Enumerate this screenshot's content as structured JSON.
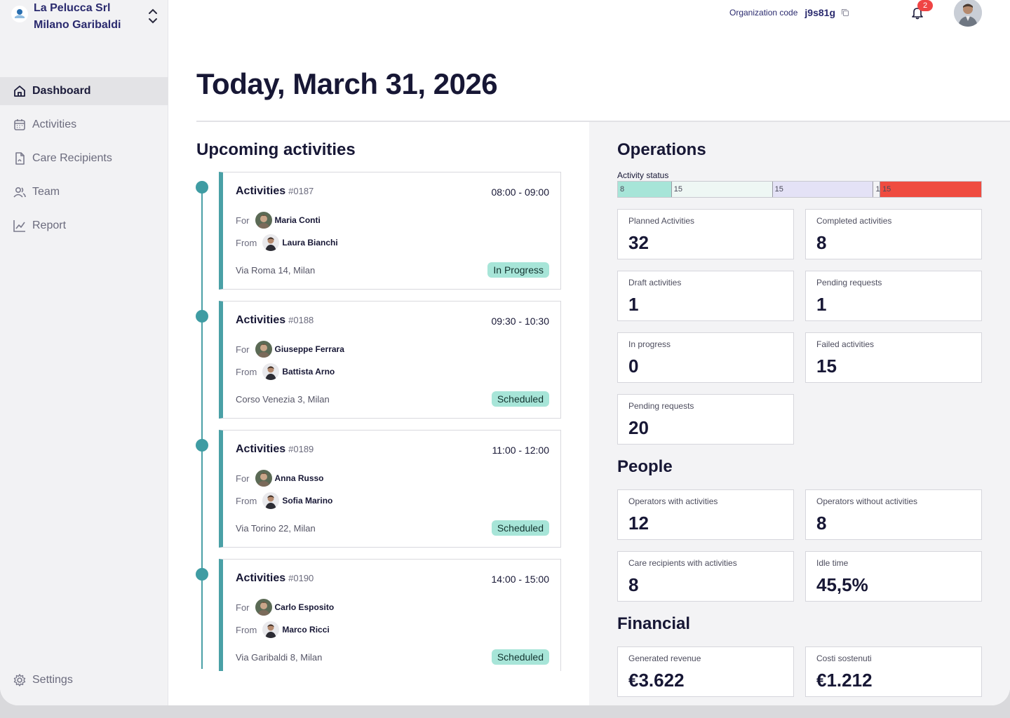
{
  "org": {
    "name": "La Pelucca Srl",
    "branch": "Milano Garibaldi"
  },
  "nav": {
    "items": [
      {
        "label": "Dashboard",
        "icon": "home-icon",
        "active": true
      },
      {
        "label": "Activities",
        "icon": "calendar-icon"
      },
      {
        "label": "Care Recipients",
        "icon": "document-icon"
      },
      {
        "label": "Team",
        "icon": "users-icon"
      },
      {
        "label": "Report",
        "icon": "chart-line-icon"
      }
    ],
    "settings_label": "Settings"
  },
  "topbar": {
    "org_code_label": "Organization code",
    "org_code": "j9s81g",
    "notifications": "2"
  },
  "page_title": "Today, March 31, 2026",
  "upcoming": {
    "title": "Upcoming activities",
    "for_label": "For",
    "from_label": "From",
    "items": [
      {
        "title": "Activities",
        "num": "#0187",
        "time": "08:00 - 09:00",
        "for": "Maria Conti",
        "from": "Laura Bianchi",
        "address": "Via Roma 14, Milan",
        "status": "In Progress"
      },
      {
        "title": "Activities",
        "num": "#0188",
        "time": "09:30 - 10:30",
        "for": "Giuseppe Ferrara",
        "from": "Battista Arno",
        "address": "Corso Venezia 3, Milan",
        "status": "Scheduled"
      },
      {
        "title": "Activities",
        "num": "#0189",
        "time": "11:00 - 12:00",
        "for": "Anna Russo",
        "from": "Sofia Marino",
        "address": "Via Torino 22, Milan",
        "status": "Scheduled"
      },
      {
        "title": "Activities",
        "num": "#0190",
        "time": "14:00 - 15:00",
        "for": "Carlo Esposito",
        "from": "Marco Ricci",
        "address": "Via Garibaldi 8, Milan",
        "status": "Scheduled"
      }
    ]
  },
  "operations": {
    "title": "Operations",
    "status_label": "Activity status",
    "status_segments": [
      {
        "value": "8",
        "color": "#a7e5d8"
      },
      {
        "value": "15",
        "color": "#eef7f4"
      },
      {
        "value": "15",
        "color": "#e4e2f6"
      },
      {
        "value": "1",
        "color": "#f3f3f5"
      },
      {
        "value": "15",
        "color": "#ef4b40"
      }
    ],
    "stats": [
      {
        "label": "Planned Activities",
        "value": "32"
      },
      {
        "label": "Completed activities",
        "value": "8"
      },
      {
        "label": "Draft activities",
        "value": "1"
      },
      {
        "label": "Pending requests",
        "value": "1"
      },
      {
        "label": "In progress",
        "value": "0"
      },
      {
        "label": "Failed activities",
        "value": "15"
      },
      {
        "label": "Pending requests",
        "value": "20"
      }
    ]
  },
  "people": {
    "title": "People",
    "stats": [
      {
        "label": "Operators with activities",
        "value": "12"
      },
      {
        "label": "Operators without activities",
        "value": "8"
      },
      {
        "label": "Care recipients with activities",
        "value": "8"
      },
      {
        "label": "Idle time",
        "value": "45,5%"
      }
    ]
  },
  "financial": {
    "title": "Financial",
    "stats": [
      {
        "label": "Generated revenue",
        "value": "€3.622"
      },
      {
        "label": "Costi sostenuti",
        "value": "€1.212"
      }
    ]
  },
  "colors": {
    "accent": "#4aa0a6",
    "status_badge": "#a7e5d8",
    "danger": "#ef4444",
    "brand_text": "#2a2a6e"
  }
}
